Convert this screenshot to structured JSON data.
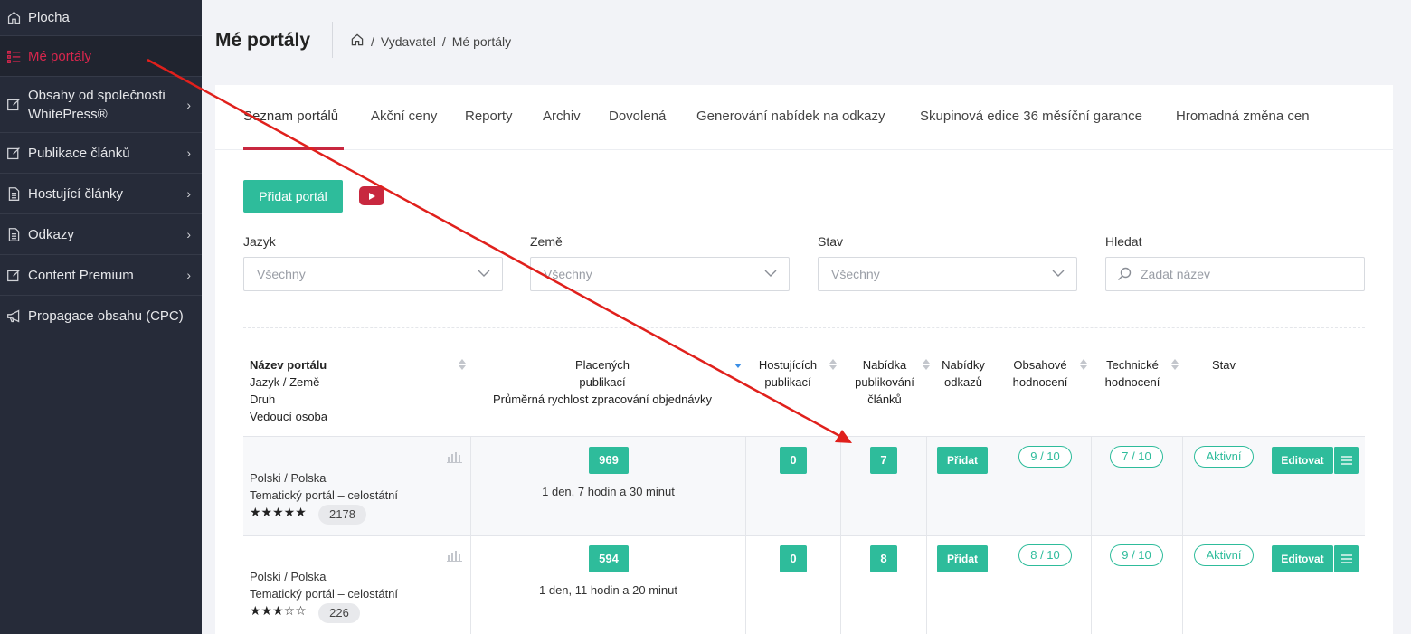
{
  "sidebar": {
    "items": [
      {
        "label": "Plocha",
        "icon": "home-icon"
      },
      {
        "label": "Mé portály",
        "icon": "list-icon"
      },
      {
        "label": "Obsahy od společnosti",
        "label2": "WhitePress®",
        "icon": "edit-icon"
      },
      {
        "label": "Publikace článků",
        "icon": "edit-icon"
      },
      {
        "label": "Hostující články",
        "icon": "document-icon"
      },
      {
        "label": "Odkazy",
        "icon": "document-icon"
      },
      {
        "label": "Content Premium",
        "icon": "edit-icon"
      },
      {
        "label": "Propagace obsahu (CPC)",
        "icon": "megaphone-icon"
      }
    ]
  },
  "header": {
    "title": "Mé portály",
    "breadcrumb": [
      "/",
      "Vydavatel",
      "/",
      "Mé portály"
    ]
  },
  "tabs": [
    "Seznam portálů",
    "Akční ceny",
    "Reporty",
    "Archiv",
    "Dovolená",
    "Generování nabídek na odkazy",
    "Skupinová edice 36 měsíční garance",
    "Hromadná změna cen"
  ],
  "toolbar": {
    "add_portal": "Přidat portál"
  },
  "filters": {
    "language": {
      "label": "Jazyk",
      "value": "Všechny"
    },
    "country": {
      "label": "Země",
      "value": "Všechny"
    },
    "state": {
      "label": "Stav",
      "value": "Všechny"
    },
    "search": {
      "label": "Hledat",
      "placeholder": "Zadat název"
    }
  },
  "table": {
    "headers": {
      "name": [
        "Název portálu",
        "Jazyk / Země",
        "Druh",
        "Vedoucí osoba"
      ],
      "paid": [
        "Placených",
        "publikací",
        "Průměrná rychlost zpracování objednávky"
      ],
      "hosting": [
        "Hostujících",
        "publikací"
      ],
      "offer": [
        "Nabídka",
        "publikování",
        "článků"
      ],
      "links": [
        "Nabídky",
        "odkazů"
      ],
      "content": [
        "Obsahové",
        "hodnocení"
      ],
      "technical": [
        "Technické",
        "hodnocení"
      ],
      "state": "Stav"
    },
    "rows": [
      {
        "lang": "Polski / Polska",
        "type": "Tematický portál – celostátní",
        "stars": "★★★★★",
        "rating_count": "2178",
        "paid": "969",
        "speed": "1 den, 7 hodin a 30 minut",
        "hosting": "0",
        "offer": "7",
        "links_btn": "Přidat",
        "content_score": "9 / 10",
        "technical_score": "7 / 10",
        "state": "Aktivní",
        "edit": "Editovat"
      },
      {
        "lang": "Polski / Polska",
        "type": "Tematický portál – celostátní",
        "stars": "★★★☆☆",
        "rating_count": "226",
        "paid": "594",
        "speed": "1 den, 11 hodin a 20 minut",
        "hosting": "0",
        "offer": "8",
        "links_btn": "Přidat",
        "content_score": "8 / 10",
        "technical_score": "9 / 10",
        "state": "Aktivní",
        "edit": "Editovat"
      }
    ]
  },
  "colors": {
    "accent": "#2ebc9b",
    "active": "#d9264d",
    "sidebar": "#262b39",
    "arrow": "#e0201c"
  }
}
